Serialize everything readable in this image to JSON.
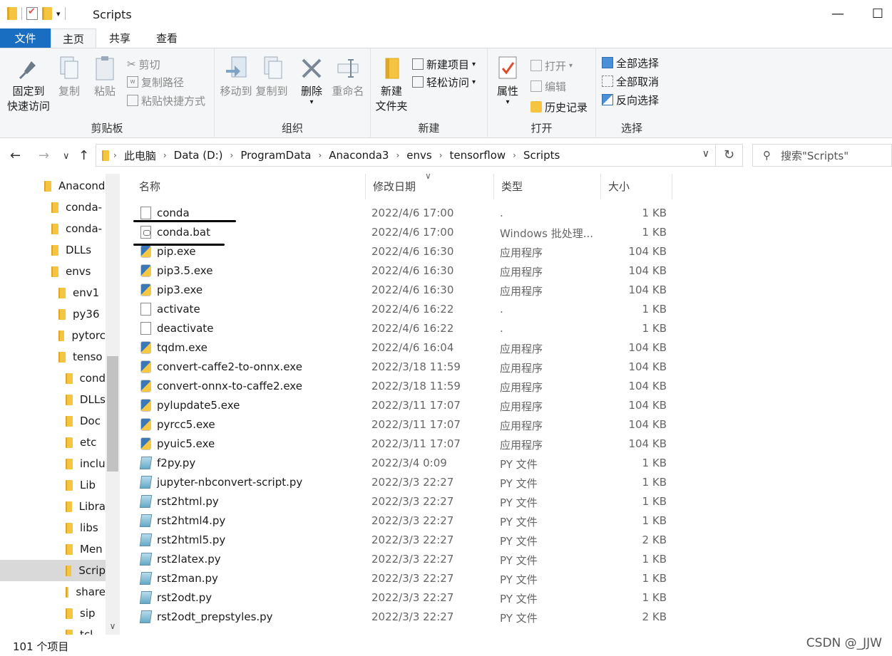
{
  "window": {
    "title": "Scripts",
    "minimize_label": "—",
    "maximize_label": "☐"
  },
  "ribbon_tabs": [
    "文件",
    "主页",
    "共享",
    "查看"
  ],
  "ribbon": {
    "clipboard": {
      "label": "剪贴板",
      "pin_label_1": "固定到",
      "pin_label_2": "快速访问",
      "copy_label": "复制",
      "paste_label": "粘贴",
      "cut_label": "剪切",
      "copy_path_label": "复制路径",
      "paste_shortcut_label": "粘贴快捷方式"
    },
    "organize": {
      "label": "组织",
      "move_to_label": "移动到",
      "copy_to_label": "复制到",
      "delete_label": "删除",
      "rename_label": "重命名"
    },
    "new": {
      "label": "新建",
      "new_folder_label_1": "新建",
      "new_folder_label_2": "文件夹",
      "new_item_label": "新建项目",
      "easy_access_label": "轻松访问"
    },
    "open": {
      "label": "打开",
      "properties_label": "属性",
      "open_label": "打开",
      "edit_label": "编辑",
      "history_label": "历史记录"
    },
    "select": {
      "label": "选择",
      "select_all_label": "全部选择",
      "select_none_label": "全部取消",
      "invert_label": "反向选择"
    }
  },
  "address": {
    "breadcrumbs": [
      "此电脑",
      "Data (D:)",
      "ProgramData",
      "Anaconda3",
      "envs",
      "tensorflow",
      "Scripts"
    ],
    "search_placeholder": "搜索\"Scripts\""
  },
  "sidebar": {
    "items": [
      {
        "label": "Anacond",
        "indent": 0
      },
      {
        "label": "conda-",
        "indent": 1
      },
      {
        "label": "conda-",
        "indent": 1
      },
      {
        "label": "DLLs",
        "indent": 1
      },
      {
        "label": "envs",
        "indent": 1
      },
      {
        "label": "env1",
        "indent": 2
      },
      {
        "label": "py36",
        "indent": 2
      },
      {
        "label": "pytorc",
        "indent": 2
      },
      {
        "label": "tenso",
        "indent": 2
      },
      {
        "label": "cond",
        "indent": 3
      },
      {
        "label": "DLLs",
        "indent": 3
      },
      {
        "label": "Doc",
        "indent": 3
      },
      {
        "label": "etc",
        "indent": 3
      },
      {
        "label": "inclu",
        "indent": 3
      },
      {
        "label": "Lib",
        "indent": 3
      },
      {
        "label": "Libra",
        "indent": 3
      },
      {
        "label": "libs",
        "indent": 3
      },
      {
        "label": "Men",
        "indent": 3
      },
      {
        "label": "Scrip",
        "indent": 3,
        "selected": true
      },
      {
        "label": "share",
        "indent": 3
      },
      {
        "label": "sip",
        "indent": 3
      },
      {
        "label": "tcl",
        "indent": 3
      }
    ]
  },
  "columns": {
    "name": "名称",
    "date": "修改日期",
    "type": "类型",
    "size": "大小"
  },
  "files": [
    {
      "name": "conda",
      "date": "2022/4/6 17:00",
      "type": ".",
      "size": "1 KB",
      "icon": "doc"
    },
    {
      "name": "conda.bat",
      "date": "2022/4/6 17:00",
      "type": "Windows 批处理...",
      "size": "1 KB",
      "icon": "bat"
    },
    {
      "name": "pip.exe",
      "date": "2022/4/6 16:30",
      "type": "应用程序",
      "size": "104 KB",
      "icon": "exe"
    },
    {
      "name": "pip3.5.exe",
      "date": "2022/4/6 16:30",
      "type": "应用程序",
      "size": "104 KB",
      "icon": "exe"
    },
    {
      "name": "pip3.exe",
      "date": "2022/4/6 16:30",
      "type": "应用程序",
      "size": "104 KB",
      "icon": "exe"
    },
    {
      "name": "activate",
      "date": "2022/4/6 16:22",
      "type": ".",
      "size": "1 KB",
      "icon": "doc"
    },
    {
      "name": "deactivate",
      "date": "2022/4/6 16:22",
      "type": ".",
      "size": "1 KB",
      "icon": "doc"
    },
    {
      "name": "tqdm.exe",
      "date": "2022/4/6 16:04",
      "type": "应用程序",
      "size": "104 KB",
      "icon": "exe"
    },
    {
      "name": "convert-caffe2-to-onnx.exe",
      "date": "2022/3/18 11:59",
      "type": "应用程序",
      "size": "104 KB",
      "icon": "exe"
    },
    {
      "name": "convert-onnx-to-caffe2.exe",
      "date": "2022/3/18 11:59",
      "type": "应用程序",
      "size": "104 KB",
      "icon": "exe"
    },
    {
      "name": "pylupdate5.exe",
      "date": "2022/3/11 17:07",
      "type": "应用程序",
      "size": "104 KB",
      "icon": "exe"
    },
    {
      "name": "pyrcc5.exe",
      "date": "2022/3/11 17:07",
      "type": "应用程序",
      "size": "104 KB",
      "icon": "exe"
    },
    {
      "name": "pyuic5.exe",
      "date": "2022/3/11 17:07",
      "type": "应用程序",
      "size": "104 KB",
      "icon": "exe"
    },
    {
      "name": "f2py.py",
      "date": "2022/3/4 0:09",
      "type": "PY 文件",
      "size": "1 KB",
      "icon": "py"
    },
    {
      "name": "jupyter-nbconvert-script.py",
      "date": "2022/3/3 22:27",
      "type": "PY 文件",
      "size": "1 KB",
      "icon": "py"
    },
    {
      "name": "rst2html.py",
      "date": "2022/3/3 22:27",
      "type": "PY 文件",
      "size": "1 KB",
      "icon": "py"
    },
    {
      "name": "rst2html4.py",
      "date": "2022/3/3 22:27",
      "type": "PY 文件",
      "size": "1 KB",
      "icon": "py"
    },
    {
      "name": "rst2html5.py",
      "date": "2022/3/3 22:27",
      "type": "PY 文件",
      "size": "2 KB",
      "icon": "py"
    },
    {
      "name": "rst2latex.py",
      "date": "2022/3/3 22:27",
      "type": "PY 文件",
      "size": "1 KB",
      "icon": "py"
    },
    {
      "name": "rst2man.py",
      "date": "2022/3/3 22:27",
      "type": "PY 文件",
      "size": "1 KB",
      "icon": "py"
    },
    {
      "name": "rst2odt.py",
      "date": "2022/3/3 22:27",
      "type": "PY 文件",
      "size": "1 KB",
      "icon": "py"
    },
    {
      "name": "rst2odt_prepstyles.py",
      "date": "2022/3/3 22:27",
      "type": "PY 文件",
      "size": "2 KB",
      "icon": "py"
    }
  ],
  "status": {
    "count": "101 个项目",
    "watermark": "CSDN @_JJW"
  },
  "colors": {
    "file_tab": "#1a6ec2",
    "selection": "#d9d9d9",
    "folder": "#f5c542"
  }
}
